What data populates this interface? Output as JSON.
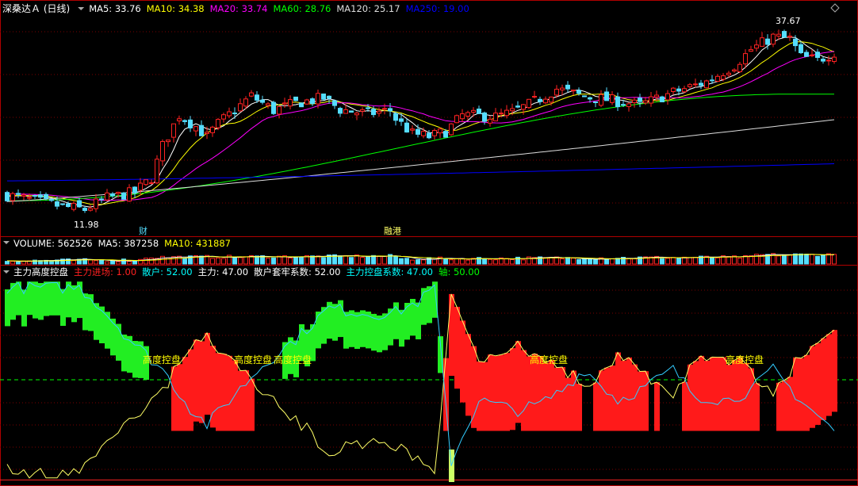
{
  "main_panel": {
    "title": "深桑达Ａ (日线)",
    "ma_items": [
      {
        "label": "MA5: 33.76",
        "color": "#ffffff"
      },
      {
        "label": "MA10: 34.38",
        "color": "#ffff00"
      },
      {
        "label": "MA20: 33.74",
        "color": "#ff00ff"
      },
      {
        "label": "MA60: 28.76",
        "color": "#00ff00"
      },
      {
        "label": "MA120: 25.17",
        "color": "#dddddd"
      },
      {
        "label": "MA250: 19.00",
        "color": "#0000ff"
      }
    ],
    "high_label": "37.67",
    "low_label": "11.98",
    "markers": [
      "财",
      "融港"
    ]
  },
  "volume_panel": {
    "items": [
      {
        "label": "VOLUME: 562526",
        "color": "#ffffff"
      },
      {
        "label": "MA5: 387258",
        "color": "#ffffff"
      },
      {
        "label": "MA10: 431887",
        "color": "#ffff00"
      }
    ]
  },
  "indicator_panel": {
    "items": [
      {
        "label": "主力高度控盘",
        "color": "#ffffff"
      },
      {
        "label": "主力进场: 1.00",
        "color": "#ff2020"
      },
      {
        "label": "散户: 52.00",
        "color": "#00ffff"
      },
      {
        "label": "主力: 47.00",
        "color": "#ffffff"
      },
      {
        "label": "散户套牢系数: 52.00",
        "color": "#ffffff"
      },
      {
        "label": "主力控盘系数: 47.00",
        "color": "#00ffff"
      },
      {
        "label": "轴: 50.00",
        "color": "#00ff00"
      }
    ],
    "annotation_text": "高度控盘"
  },
  "chart_data": {
    "type": "line",
    "title": "深桑达Ａ (日线)",
    "ma_latest": {
      "MA5": 33.76,
      "MA10": 34.38,
      "MA20": 33.74,
      "MA60": 28.76,
      "MA120": 25.17,
      "MA250": 19.0
    },
    "price_range": {
      "low": 11.98,
      "high": 37.67
    },
    "volume_latest": {
      "VOLUME": 562526,
      "MA5": 387258,
      "MA10": 431887
    },
    "indicator_latest": {
      "主力进场": 1.0,
      "散户": 52.0,
      "主力": 47.0,
      "散户套牢系数": 52.0,
      "主力控盘系数": 47.0,
      "轴": 50.0
    },
    "indicator_ylim": [
      0,
      100
    ],
    "candles_count": 150,
    "colors": {
      "up": "#ff2222",
      "down": "#55ddff",
      "bg": "#000000",
      "grid": "#990000",
      "separator": "#b00000"
    }
  }
}
